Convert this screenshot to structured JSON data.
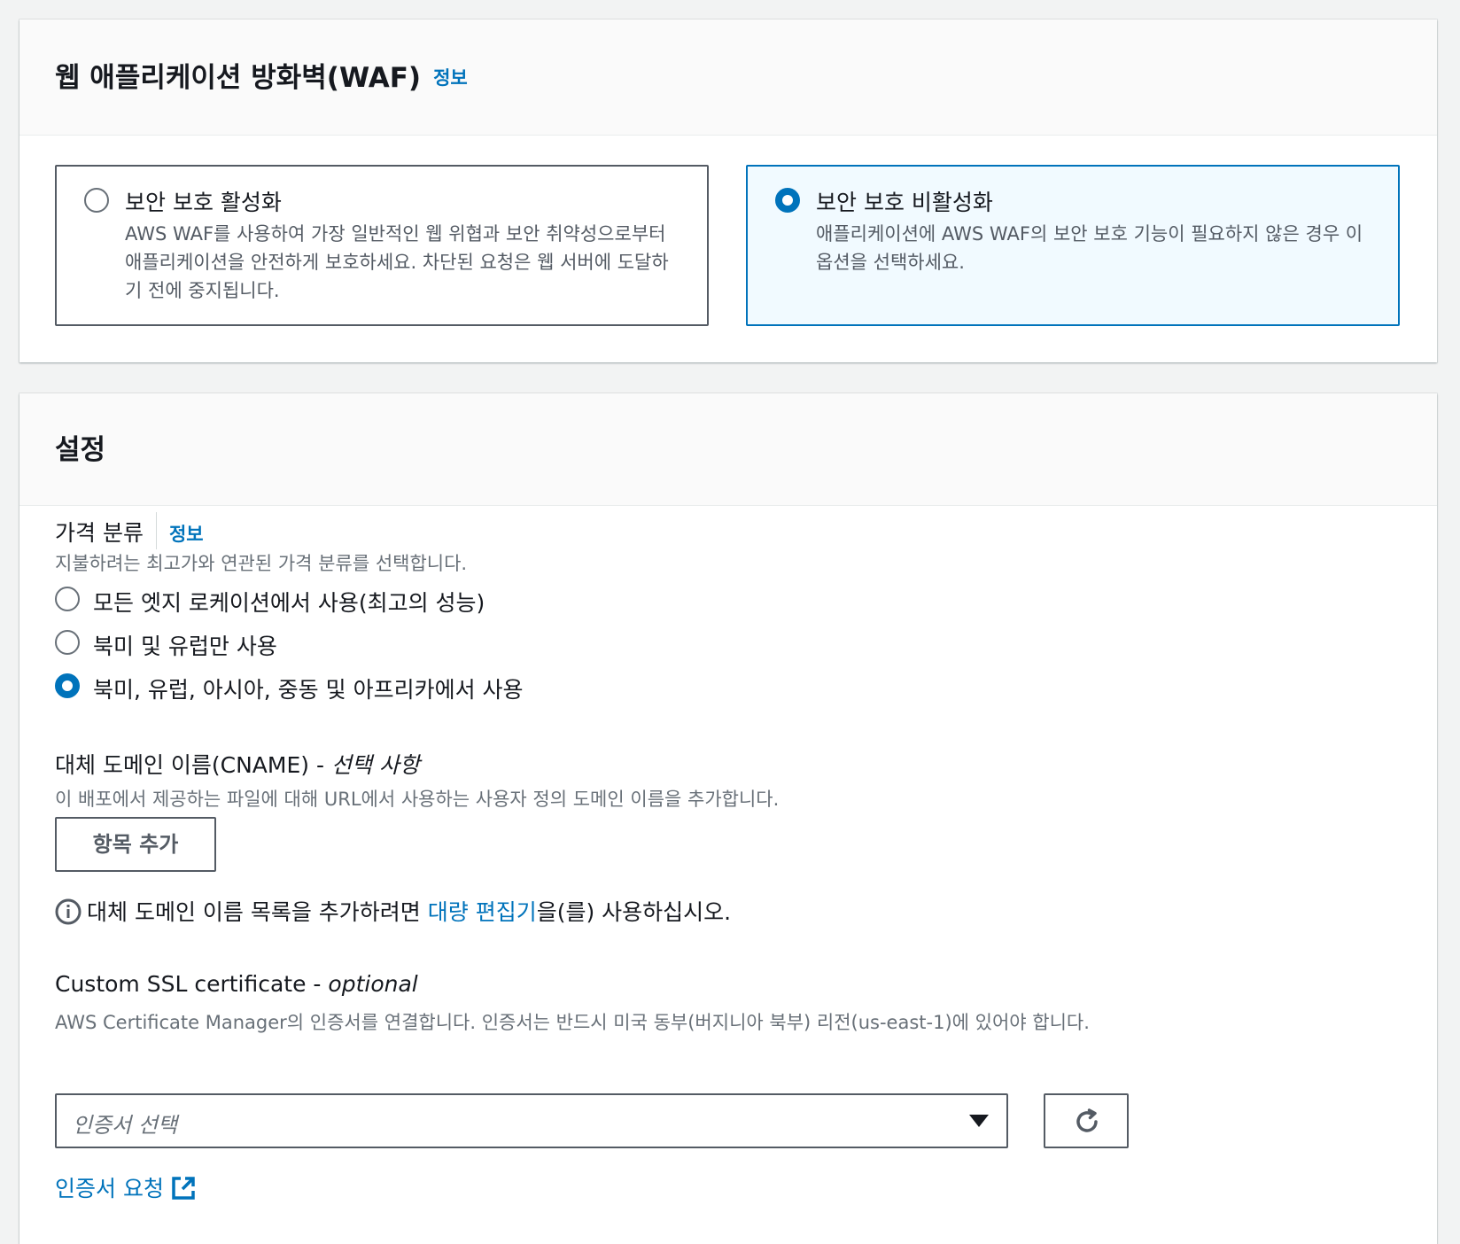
{
  "waf": {
    "title": "웹 애플리케이션 방화벽(WAF)",
    "info": "정보",
    "options": [
      {
        "title": "보안 보호 활성화",
        "description": "AWS WAF를 사용하여 가장 일반적인 웹 위협과 보안 취약성으로부터 애플리케이션을 안전하게 보호하세요. 차단된 요청은 웹 서버에 도달하기 전에 중지됩니다.",
        "selected": false
      },
      {
        "title": "보안 보호 비활성화",
        "description": "애플리케이션에 AWS WAF의 보안 보호 기능이 필요하지 않은 경우 이 옵션을 선택하세요.",
        "selected": true
      }
    ]
  },
  "settings": {
    "title": "설정",
    "price_class": {
      "label": "가격 분류",
      "info": "정보",
      "description": "지불하려는 최고가와 연관된 가격 분류를 선택합니다.",
      "options": [
        {
          "label": "모든 엣지 로케이션에서 사용(최고의 성능)",
          "selected": false
        },
        {
          "label": "북미 및 유럽만 사용",
          "selected": false
        },
        {
          "label": "북미, 유럽, 아시아, 중동 및 아프리카에서 사용",
          "selected": true
        }
      ]
    },
    "cname": {
      "label": "대체 도메인 이름(CNAME) - ",
      "optional": "선택 사항",
      "description": "이 배포에서 제공하는 파일에 대해 URL에서 사용하는 사용자 정의 도메인 이름을 추가합니다.",
      "add_button": "항목 추가",
      "note_prefix": "대체 도메인 이름 목록을 추가하려면 ",
      "note_link": "대량 편집기",
      "note_suffix": "을(를) 사용하십시오."
    },
    "ssl": {
      "label": "Custom SSL certificate - ",
      "optional": "optional",
      "description": "AWS Certificate Manager의 인증서를 연결합니다. 인증서는 반드시 미국 동부(버지니아 북부) 리전(us-east-1)에 있어야 합니다.",
      "select_placeholder": "인증서 선택",
      "request_link": "인증서 요청"
    }
  },
  "colors": {
    "link": "#0073bb",
    "selected_border": "#0073bb",
    "selected_bg": "#f1faff",
    "border": "#545b64",
    "secondary_text": "#687078"
  },
  "icons": {
    "refresh": "refresh-icon",
    "external": "external-link-icon",
    "info": "info-icon",
    "dropdown": "caret-down-icon"
  }
}
